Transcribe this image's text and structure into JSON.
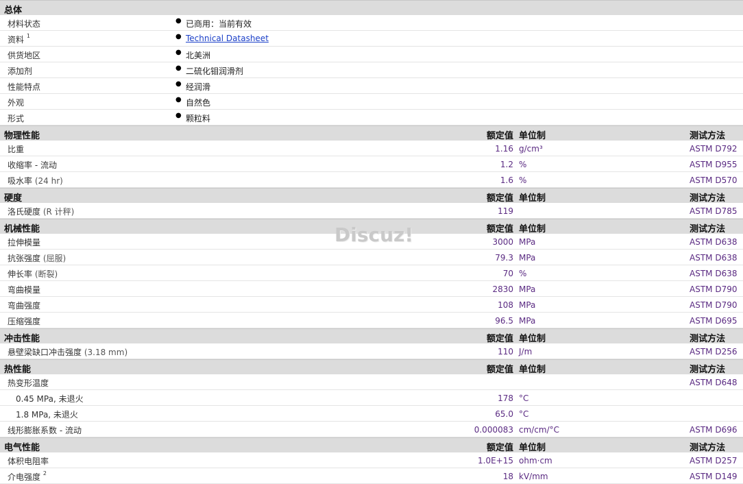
{
  "general": {
    "title": "总体",
    "rows": [
      {
        "label": "材料状态",
        "value": "已商用：当前有效"
      },
      {
        "label": "资料",
        "sup": "1",
        "value": "Technical Datasheet"
      },
      {
        "label": "供货地区",
        "value": "北美洲"
      },
      {
        "label": "添加剂",
        "value": "二硫化钼润滑剂"
      },
      {
        "label": "性能特点",
        "value": "经润滑"
      },
      {
        "label": "外观",
        "value": "自然色"
      },
      {
        "label": "形式",
        "value": "颗粒料"
      }
    ]
  },
  "col_headers": {
    "value": "额定值",
    "unit": "单位制",
    "method": "测试方法"
  },
  "physical": {
    "title": "物理性能",
    "rows": [
      {
        "label": "比重",
        "value": "1.16",
        "unit": "g/cm³",
        "method": "ASTM D792"
      },
      {
        "label": "收缩率 - 流动",
        "value": "1.2",
        "unit": "%",
        "method": "ASTM D955"
      },
      {
        "label": "吸水率",
        "paren": "(24 hr)",
        "value": "1.6",
        "unit": "%",
        "method": "ASTM D570"
      }
    ]
  },
  "hardness": {
    "title": "硬度",
    "rows": [
      {
        "label": "洛氏硬度",
        "paren": "(R 计秤)",
        "value": "119",
        "unit": "",
        "method": "ASTM D785"
      }
    ]
  },
  "mechanical": {
    "title": "机械性能",
    "rows": [
      {
        "label": "拉伸模量",
        "value": "3000",
        "unit": "MPa",
        "method": "ASTM D638"
      },
      {
        "label": "抗张强度",
        "paren": "(屈服)",
        "value": "79.3",
        "unit": "MPa",
        "method": "ASTM D638"
      },
      {
        "label": "伸长率",
        "paren": "(断裂)",
        "value": "70",
        "unit": "%",
        "method": "ASTM D638"
      },
      {
        "label": "弯曲模量",
        "value": "2830",
        "unit": "MPa",
        "method": "ASTM D790"
      },
      {
        "label": "弯曲强度",
        "value": "108",
        "unit": "MPa",
        "method": "ASTM D790"
      },
      {
        "label": "压缩强度",
        "value": "96.5",
        "unit": "MPa",
        "method": "ASTM D695"
      }
    ]
  },
  "impact": {
    "title": "冲击性能",
    "rows": [
      {
        "label": "悬壁梁缺口冲击强度",
        "paren": "(3.18 mm)",
        "value": "110",
        "unit": "J/m",
        "method": "ASTM D256"
      }
    ]
  },
  "thermal": {
    "title": "热性能",
    "rows": [
      {
        "label": "热变形温度",
        "value": "",
        "unit": "",
        "method": "ASTM D648"
      },
      {
        "label": "0.45 MPa, 未退火",
        "value": "178",
        "unit": "°C",
        "method": ""
      },
      {
        "label": "1.8 MPa, 未退火",
        "value": "65.0",
        "unit": "°C",
        "method": ""
      },
      {
        "label": "线形膨胀系数 - 流动",
        "value": "0.000083",
        "unit": "cm/cm/°C",
        "method": "ASTM D696"
      }
    ]
  },
  "electrical": {
    "title": "电气性能",
    "rows": [
      {
        "label": "体积电阻率",
        "value": "1.0E+15",
        "unit": "ohm·cm",
        "method": "ASTM D257"
      },
      {
        "label": "介电强度",
        "sup": "2",
        "value": "18",
        "unit": "kV/mm",
        "method": "ASTM D149"
      }
    ]
  },
  "watermark": "Discuz!"
}
